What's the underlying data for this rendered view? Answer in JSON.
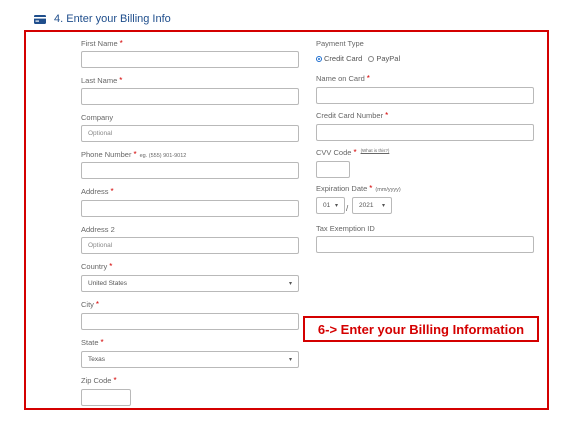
{
  "section": {
    "icon": "credit-card-icon",
    "title": "4. Enter your Billing Info"
  },
  "left": {
    "first_name": {
      "label": "First Name",
      "required": "*",
      "value": ""
    },
    "last_name": {
      "label": "Last Name",
      "required": "*",
      "value": ""
    },
    "company": {
      "label": "Company",
      "placeholder": "Optional"
    },
    "phone": {
      "label": "Phone Number",
      "required": "*",
      "hint": "eg. (555) 901-9012",
      "value": ""
    },
    "address": {
      "label": "Address",
      "required": "*",
      "value": ""
    },
    "address2": {
      "label": "Address 2",
      "placeholder": "Optional"
    },
    "country": {
      "label": "Country",
      "required": "*",
      "selected": "United States"
    },
    "city": {
      "label": "City",
      "required": "*",
      "value": ""
    },
    "state": {
      "label": "State",
      "required": "*",
      "selected": "Texas"
    },
    "zip": {
      "label": "Zip Code",
      "required": "*",
      "value": ""
    }
  },
  "right": {
    "payment_type": {
      "label": "Payment Type",
      "options": [
        {
          "label": "Credit Card",
          "checked": true
        },
        {
          "label": "PayPal",
          "checked": false
        }
      ]
    },
    "name_on_card": {
      "label": "Name on Card",
      "required": "*",
      "value": ""
    },
    "card_number": {
      "label": "Credit Card Number",
      "required": "*",
      "value": ""
    },
    "cvv": {
      "label": "CVV Code",
      "required": "*",
      "link": "(What is this?)",
      "value": ""
    },
    "expiration": {
      "label": "Expiration Date",
      "required": "*",
      "hint": "(mm/yyyy)",
      "month": "01",
      "slash": "/",
      "year": "2021"
    },
    "tax_exemption": {
      "label": "Tax Exemption ID",
      "value": ""
    }
  },
  "callout": {
    "text": "6-> Enter your Billing Information"
  },
  "colors": {
    "accent_red": "#d40000",
    "header_blue": "#1f4e8c",
    "radio_blue": "#1f6fd0"
  }
}
